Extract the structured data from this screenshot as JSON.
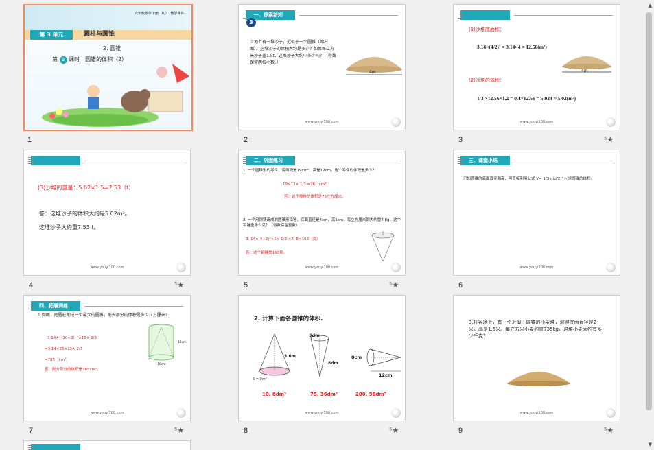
{
  "slides": [
    {
      "num": "1"
    },
    {
      "num": "2",
      "banner": "一、探索新知",
      "circle": "3",
      "body": "工地上有一堆沙子，近似于一个圆锥（如右图）。这堆沙子的体积大约是多少？如果每立方米沙子重1.5t，这堆沙子大约中多少吨？（得数保留两位小数。）",
      "dim": "4m",
      "footer": "www.youyi100.com"
    },
    {
      "num": "3",
      "q1": "(1)沙堆底面积：",
      "eq1": "3.14×(4/2)² = 3.14×4 = 12.56(m²)",
      "q2": "(2)沙堆的体积：",
      "eq2": "1/3 ×12.56×1.2 = 0.4×12.56 = 5.024 ≈ 5.02(m³)",
      "dim": "4m",
      "footer": "www.youyi100.com"
    },
    {
      "num": "4",
      "q3": "(3)沙堆的重量：5.02×1.5=7.53（t）",
      "ans1": "答：这堆沙子的体积大约是5.02m³。",
      "ans2": "这堆沙子大约重7.53 t。",
      "footer": "www.youyi100.com"
    },
    {
      "num": "5",
      "banner": "二、巩固练习",
      "p1": "1. 一个圆锥形的零件，底面积是19cm²，高是12cm。这个零件的体积是多少？",
      "p1calc": "19×12× 1/3 =76（cm³）",
      "p1ans": "答：这个零件的体积是76立方厘米。",
      "p2": "2. 一个用钢铸造成的圆锥形铅锤，底面直径是4cm，高5cm。每立方厘米钢大约重7.8g，这个铅锤重多少克？（得数保留整数）",
      "p2calc": "3. 14×(4÷2)²×5× 1/3 ×7. 8≈163（克）",
      "p2ans": "答：这个铅锤重163克。",
      "footer": "www.youyi100.com"
    },
    {
      "num": "6",
      "banner": "三、课堂小结",
      "body": "已知圆锥的底面直径和高，可直接利用公式 V= 1/3 π(d/2)² h 求圆锥的体积。",
      "footer": "www.youyi100.com"
    },
    {
      "num": "7",
      "banner": "四、拓展训练",
      "q": "1.如图，把圆柱削成一个最大的圆锥，削去部分的体积是多少立方厘米？",
      "c1": "3.14×（10÷2）²×15× 2/3",
      "c2": "=3.14×25×15× 2/3",
      "c3": "=785（cm³）",
      "ans": "答：削去部分的体积是785cm³。",
      "d1": "15cm",
      "d2": "10cm",
      "footer": "www.youyi100.com"
    },
    {
      "num": "8",
      "title": "2. 计算下面各圆锥的体积.",
      "labels": [
        "3.6m",
        "S = 9m²",
        "3dm",
        "8dm",
        "8cm",
        "12cm"
      ],
      "answers": [
        "10. 8dm³",
        "75. 36dm³",
        "200. 96dm³"
      ],
      "footer": "www.youyi100.com"
    },
    {
      "num": "9",
      "body": "3.打谷场上，有一个近似于圆锥的小麦堆，测得底面直径是2米，高是1.5米。每立方米小麦约重735kg，这堆小麦大约有多少千克？",
      "footer": "www.youyi100.com"
    }
  ],
  "slide1": {
    "header": "六年级数学下册（RJ）　教学课件",
    "unit": "第 3 单元",
    "unitTitle": "圆柱与圆锥",
    "sub": "2. 圆锥",
    "lesson1": "第",
    "lessonNum": "3",
    "lesson2": "课时　圆锥的体积（2）"
  },
  "colors": {
    "accent": "#21a8b8",
    "selected": "#f08a5d",
    "red": "#e02020"
  }
}
